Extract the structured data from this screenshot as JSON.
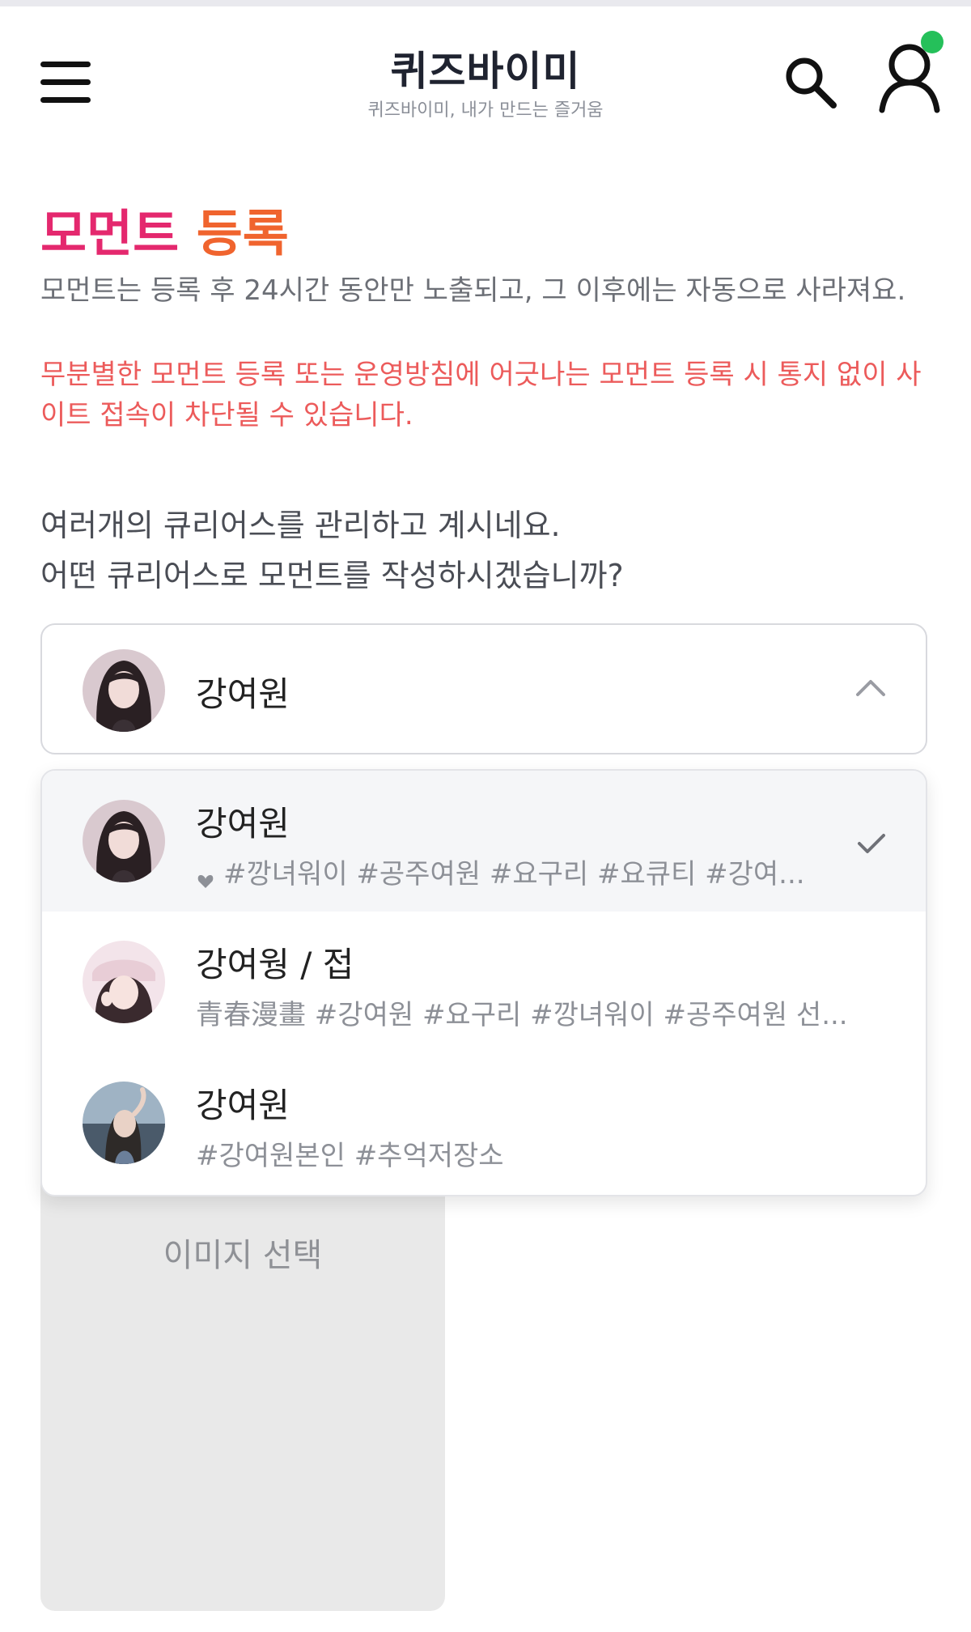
{
  "header": {
    "logo": "퀴즈바이미",
    "tagline": "퀴즈바이미, 내가 만드는 즐거움",
    "menu_icon": "hamburger-menu-icon",
    "search_icon": "search-icon",
    "user_icon": "user-profile-icon",
    "online_status_color": "#25c05a"
  },
  "page": {
    "title_part1": "모먼트",
    "title_part2": "등록",
    "title_colors": [
      "#e4286e",
      "#f0642e"
    ],
    "description": "모먼트는 등록 후 24시간 동안만 노출되고, 그 이후에는 자동으로 사라져요.",
    "warning": "무분별한 모먼트 등록 또는 운영방침에 어긋나는 모먼트 등록 시 통지 없이 사이트 접속이 차단될 수 있습니다.",
    "question_line1": "여러개의 큐리어스를 관리하고 계시네요.",
    "question_line2": "어떤 큐리어스로 모먼트를 작성하시겠습니까?"
  },
  "select": {
    "selected_name": "강여원",
    "chevron_icon": "chevron-up-icon"
  },
  "dropdown": {
    "options": [
      {
        "name": "강여원",
        "tags": "#깡녀워이 #공주여원 #요구리 #요큐티 #강여...",
        "selected": true
      },
      {
        "name": "강여웡 / 접",
        "tags": "青春漫畫 #강여원 #요구리 #깡녀워이 #공주여원 선...",
        "selected": false
      },
      {
        "name": "강여원",
        "tags": "#강여원본인 #추억저장소",
        "selected": false
      }
    ]
  },
  "image_picker": {
    "label": "이미지 선택"
  }
}
